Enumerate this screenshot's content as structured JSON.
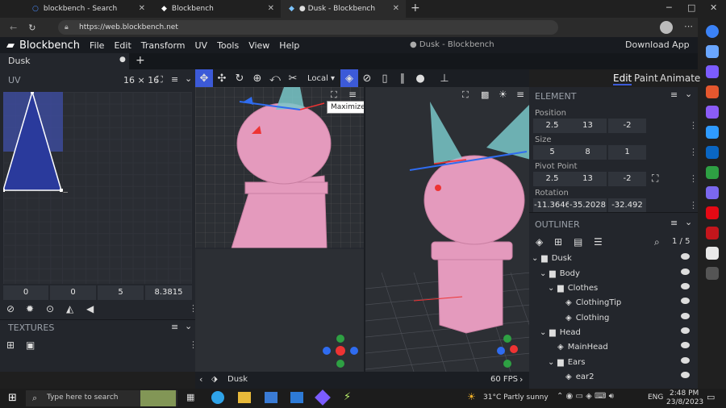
{
  "browser": {
    "tabs": [
      {
        "label": "blockbench - Search"
      },
      {
        "label": "Blockbench"
      },
      {
        "label": "● Dusk - Blockbench"
      }
    ],
    "url": "https://web.blockbench.net"
  },
  "app": {
    "name": "Blockbench",
    "menu": [
      "File",
      "Edit",
      "Transform",
      "UV",
      "Tools",
      "View",
      "Help"
    ],
    "window_title": "● Dusk - Blockbench",
    "download": "Download App",
    "project_tab": "Dusk"
  },
  "uv_panel": {
    "title": "UV",
    "size": "16 × 16",
    "fields": [
      "0",
      "0",
      "5",
      "8.3815"
    ]
  },
  "textures_panel": {
    "title": "TEXTURES"
  },
  "toolbar": {
    "space": "Local",
    "tooltip": "Maximize"
  },
  "modes": [
    "Edit",
    "Paint",
    "Animate"
  ],
  "element": {
    "title": "ELEMENT",
    "position_label": "Position",
    "position": [
      "2.5",
      "13",
      "-2"
    ],
    "size_label": "Size",
    "size": [
      "5",
      "8",
      "1"
    ],
    "pivot_label": "Pivot Point",
    "pivot": [
      "2.5",
      "13",
      "-2"
    ],
    "rotation_label": "Rotation",
    "rotation": [
      "-11.3646",
      "-35.2028",
      "-32.492"
    ]
  },
  "outliner": {
    "title": "OUTLINER",
    "count": "1 / 5",
    "items": [
      {
        "label": "Dusk",
        "type": "folder"
      },
      {
        "label": "Body",
        "type": "folder"
      },
      {
        "label": "Clothes",
        "type": "folder"
      },
      {
        "label": "ClothingTip",
        "type": "cube"
      },
      {
        "label": "Clothing",
        "type": "cube"
      },
      {
        "label": "Head",
        "type": "folder"
      },
      {
        "label": "MainHead",
        "type": "cube"
      },
      {
        "label": "Ears",
        "type": "folder"
      },
      {
        "label": "ear2",
        "type": "cube"
      }
    ]
  },
  "status": {
    "project": "Dusk",
    "fps": "60 FPS"
  },
  "taskbar": {
    "search_placeholder": "Type here to search",
    "weather": "31°C  Partly sunny",
    "lang": "ENG",
    "time": "2:48 PM",
    "date": "23/8/2023"
  },
  "colors": {
    "accent": "#3c5ad8",
    "mesh": "#e49abd",
    "uv_fill": "#2a3a9c"
  }
}
